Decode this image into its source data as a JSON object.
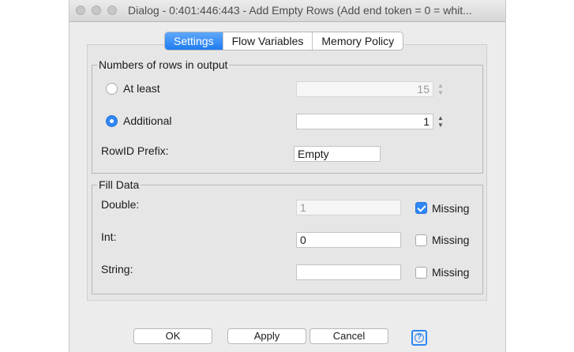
{
  "window": {
    "title": "Dialog - 0:401:446:443 - Add Empty Rows (Add end token = 0 = whit..."
  },
  "tabs": [
    {
      "label": "Settings",
      "active": true
    },
    {
      "label": "Flow Variables",
      "active": false
    },
    {
      "label": "Memory Policy",
      "active": false
    }
  ],
  "rows_group": {
    "title": "Numbers of rows in output",
    "at_least": {
      "label": "At least",
      "selected": false,
      "value": "15"
    },
    "additional": {
      "label": "Additional",
      "selected": true,
      "value": "1"
    },
    "rowid_prefix": {
      "label": "RowID Prefix:",
      "value": "Empty"
    }
  },
  "fill_group": {
    "title": "Fill Data",
    "double": {
      "label": "Double:",
      "value": "1",
      "missing_label": "Missing",
      "missing_checked": true
    },
    "int": {
      "label": "Int:",
      "value": "0",
      "missing_label": "Missing",
      "missing_checked": false
    },
    "string": {
      "label": "String:",
      "value": "",
      "missing_label": "Missing",
      "missing_checked": false
    }
  },
  "buttons": {
    "ok": "OK",
    "apply": "Apply",
    "cancel": "Cancel"
  },
  "colors": {
    "accent": "#2f87f5",
    "window_bg": "#ececec"
  },
  "icons": {
    "spinner": "spinner-arrows-icon",
    "help": "help-icon"
  }
}
